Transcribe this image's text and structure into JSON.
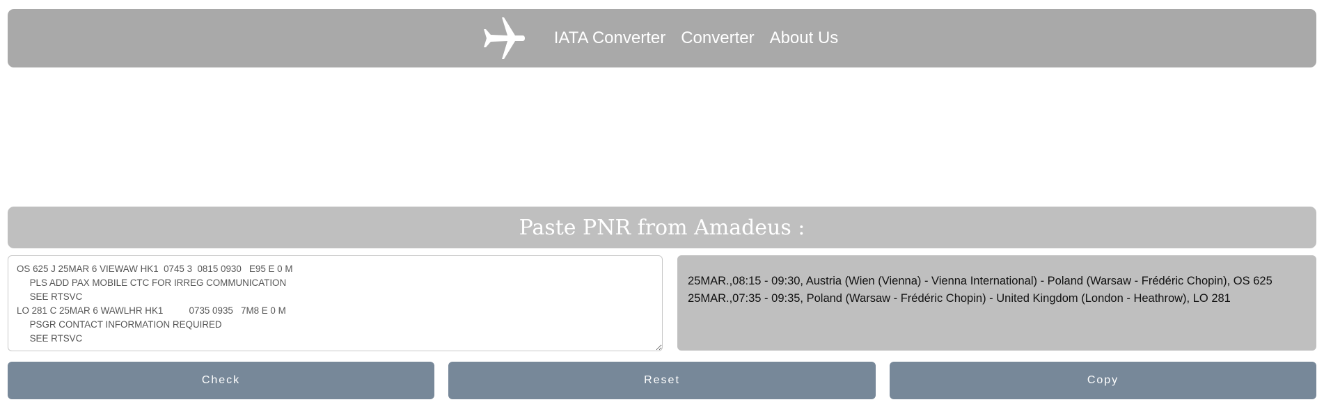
{
  "header": {
    "logo_icon": "airplane-icon",
    "nav": {
      "iata_converter": "IATA Converter",
      "converter": "Converter",
      "about_us": "About Us"
    }
  },
  "section": {
    "title": "Paste PNR from Amadeus :"
  },
  "pnr_input": {
    "value": "OS 625 J 25MAR 6 VIEWAW HK1  0745 3  0815 0930   E95 E 0 M\n     PLS ADD PAX MOBILE CTC FOR IRREG COMMUNICATION\n     SEE RTSVC\nLO 281 C 25MAR 6 WAWLHR HK1          0735 0935   7M8 E 0 M\n     PSGR CONTACT INFORMATION REQUIRED\n     SEE RTSVC"
  },
  "results": [
    "25MAR.,08:15 - 09:30, Austria (Wien (Vienna) - Vienna International) - Poland (Warsaw - Frédéric Chopin), OS 625",
    "25MAR.,07:35 - 09:35, Poland (Warsaw - Frédéric Chopin) - United Kingdom (London - Heathrow), LO 281"
  ],
  "buttons": {
    "check": "Check",
    "reset": "Reset",
    "copy": "Copy"
  },
  "colors": {
    "navbar_bg": "#a9a9a9",
    "section_bg": "#bfbfbf",
    "button_bg": "#778899",
    "result_bg": "#bfbfbf"
  }
}
